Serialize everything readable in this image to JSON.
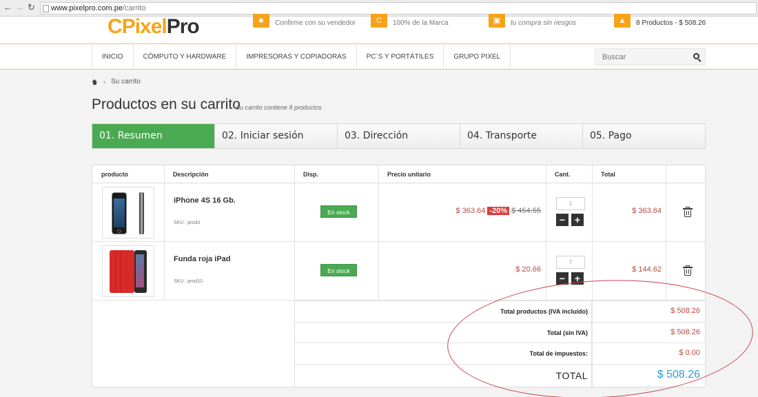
{
  "browser": {
    "url_host": "www.pixelpro.com.pe",
    "url_path": "/carrito"
  },
  "header": {
    "logo_c": "C",
    "logo_pixel": "Pixel",
    "logo_pro": "Pro",
    "features": [
      {
        "icon": "truck-icon",
        "text": "Confirme con su vendedor"
      },
      {
        "icon": "brand-c-icon",
        "text": "100% de la Marca"
      },
      {
        "icon": "credit-card-icon",
        "text": "tu compra sin riesgos"
      }
    ],
    "cart_summary": "8 Productos - $ 508.26"
  },
  "menu": [
    "Inicio",
    "Cómputo y Hardware",
    "Impresoras y Copiadoras",
    "PC´s y Portátiles",
    "Grupo Pixel"
  ],
  "search": {
    "placeholder": "Buscar"
  },
  "breadcrumb": {
    "current": "Su carrito"
  },
  "page": {
    "title": "Productos en su carrito",
    "subtitle": "Su carrito contiene 8 productos"
  },
  "steps": [
    "01. Resumen",
    "02. Iniciar sesión",
    "03. Dirección",
    "04. Transporte",
    "05. Pago"
  ],
  "cart": {
    "columns": {
      "product": "producto",
      "description": "Descripción",
      "availability": "Disp.",
      "unit_price": "Precio unitario",
      "qty": "Cant.",
      "total": "Total"
    },
    "rows": [
      {
        "name": "iPhone 4S 16 Gb.",
        "sku": "SKU : prod3",
        "stock": "En stock",
        "price": "$ 363.64",
        "discount": "-20%",
        "old_price": "$ 454.55",
        "qty": "1",
        "total": "$ 363.64"
      },
      {
        "name": "Funda roja iPad",
        "sku": "SKU : prod10",
        "stock": "En stock",
        "price": "$ 20.66",
        "qty": "7",
        "total": "$ 144.62"
      }
    ],
    "summary": {
      "products_label": "Total productos (IVA incluido)",
      "products_value": "$ 508.26",
      "no_tax_label": "Total (sin IVA)",
      "no_tax_value": "$ 508.26",
      "tax_label": "Total de impuestos:",
      "tax_value": "$ 0.00",
      "grand_label": "TOTAL",
      "grand_value": "$ 508.26"
    }
  },
  "colors": {
    "accent_orange": "#f6a31a",
    "active_green": "#4aaa52",
    "price_red": "#b84a40",
    "total_blue": "#2e9ec8",
    "annotation_red": "#c8454e"
  }
}
